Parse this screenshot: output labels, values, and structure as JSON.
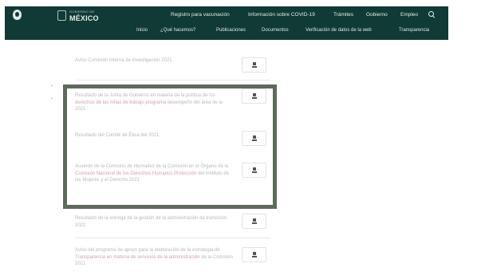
{
  "header": {
    "logo_small": "GOBIERNO DE",
    "logo_big": "MÉXICO",
    "nav_top": [
      "Registro para vacunación",
      "Información sobre COVID-19",
      "Trámites",
      "Gobierno",
      "Empleo"
    ],
    "nav_bottom": [
      "Inicio",
      "¿Qué hacemos?",
      "Publicaciones",
      "Documentos",
      "Verificación de datos de la web",
      "Transparencia"
    ]
  },
  "documents": [
    {
      "title": "Aviso Comisión Interna de Investigación 2021",
      "label_extra": ""
    },
    {
      "title": "Resultado de la Junta de Gobierno en materia de la política de los ",
      "title_pink": "derechos de las niñas de trabajo programa",
      "title_tail": " desempeño del área de la 2021",
      "label_extra": ""
    },
    {
      "title": "Resultado del Comité de Ética del 2021",
      "label_extra": ""
    },
    {
      "title": "Acuerdo de la Comisión de Honradez de la Comisión en el Órgano de la ",
      "title_pink": "Comisión Nacional de los Derechos Humanos Protección",
      "title_tail": " del Instituto de las Mujeres y el Derecho 2021",
      "label_extra": ""
    },
    {
      "title": "Resultado de la entrega de la gestión de la administración de transición 2021",
      "label_extra": ""
    },
    {
      "title": "Aviso del programa de apoyo para la elaboración de la estrategia de ",
      "title_pink": "Transparencia en materia de servicios de la administración",
      "title_tail": " de la Comisión 2021",
      "label_extra": ""
    }
  ],
  "download_label": "Descargar"
}
